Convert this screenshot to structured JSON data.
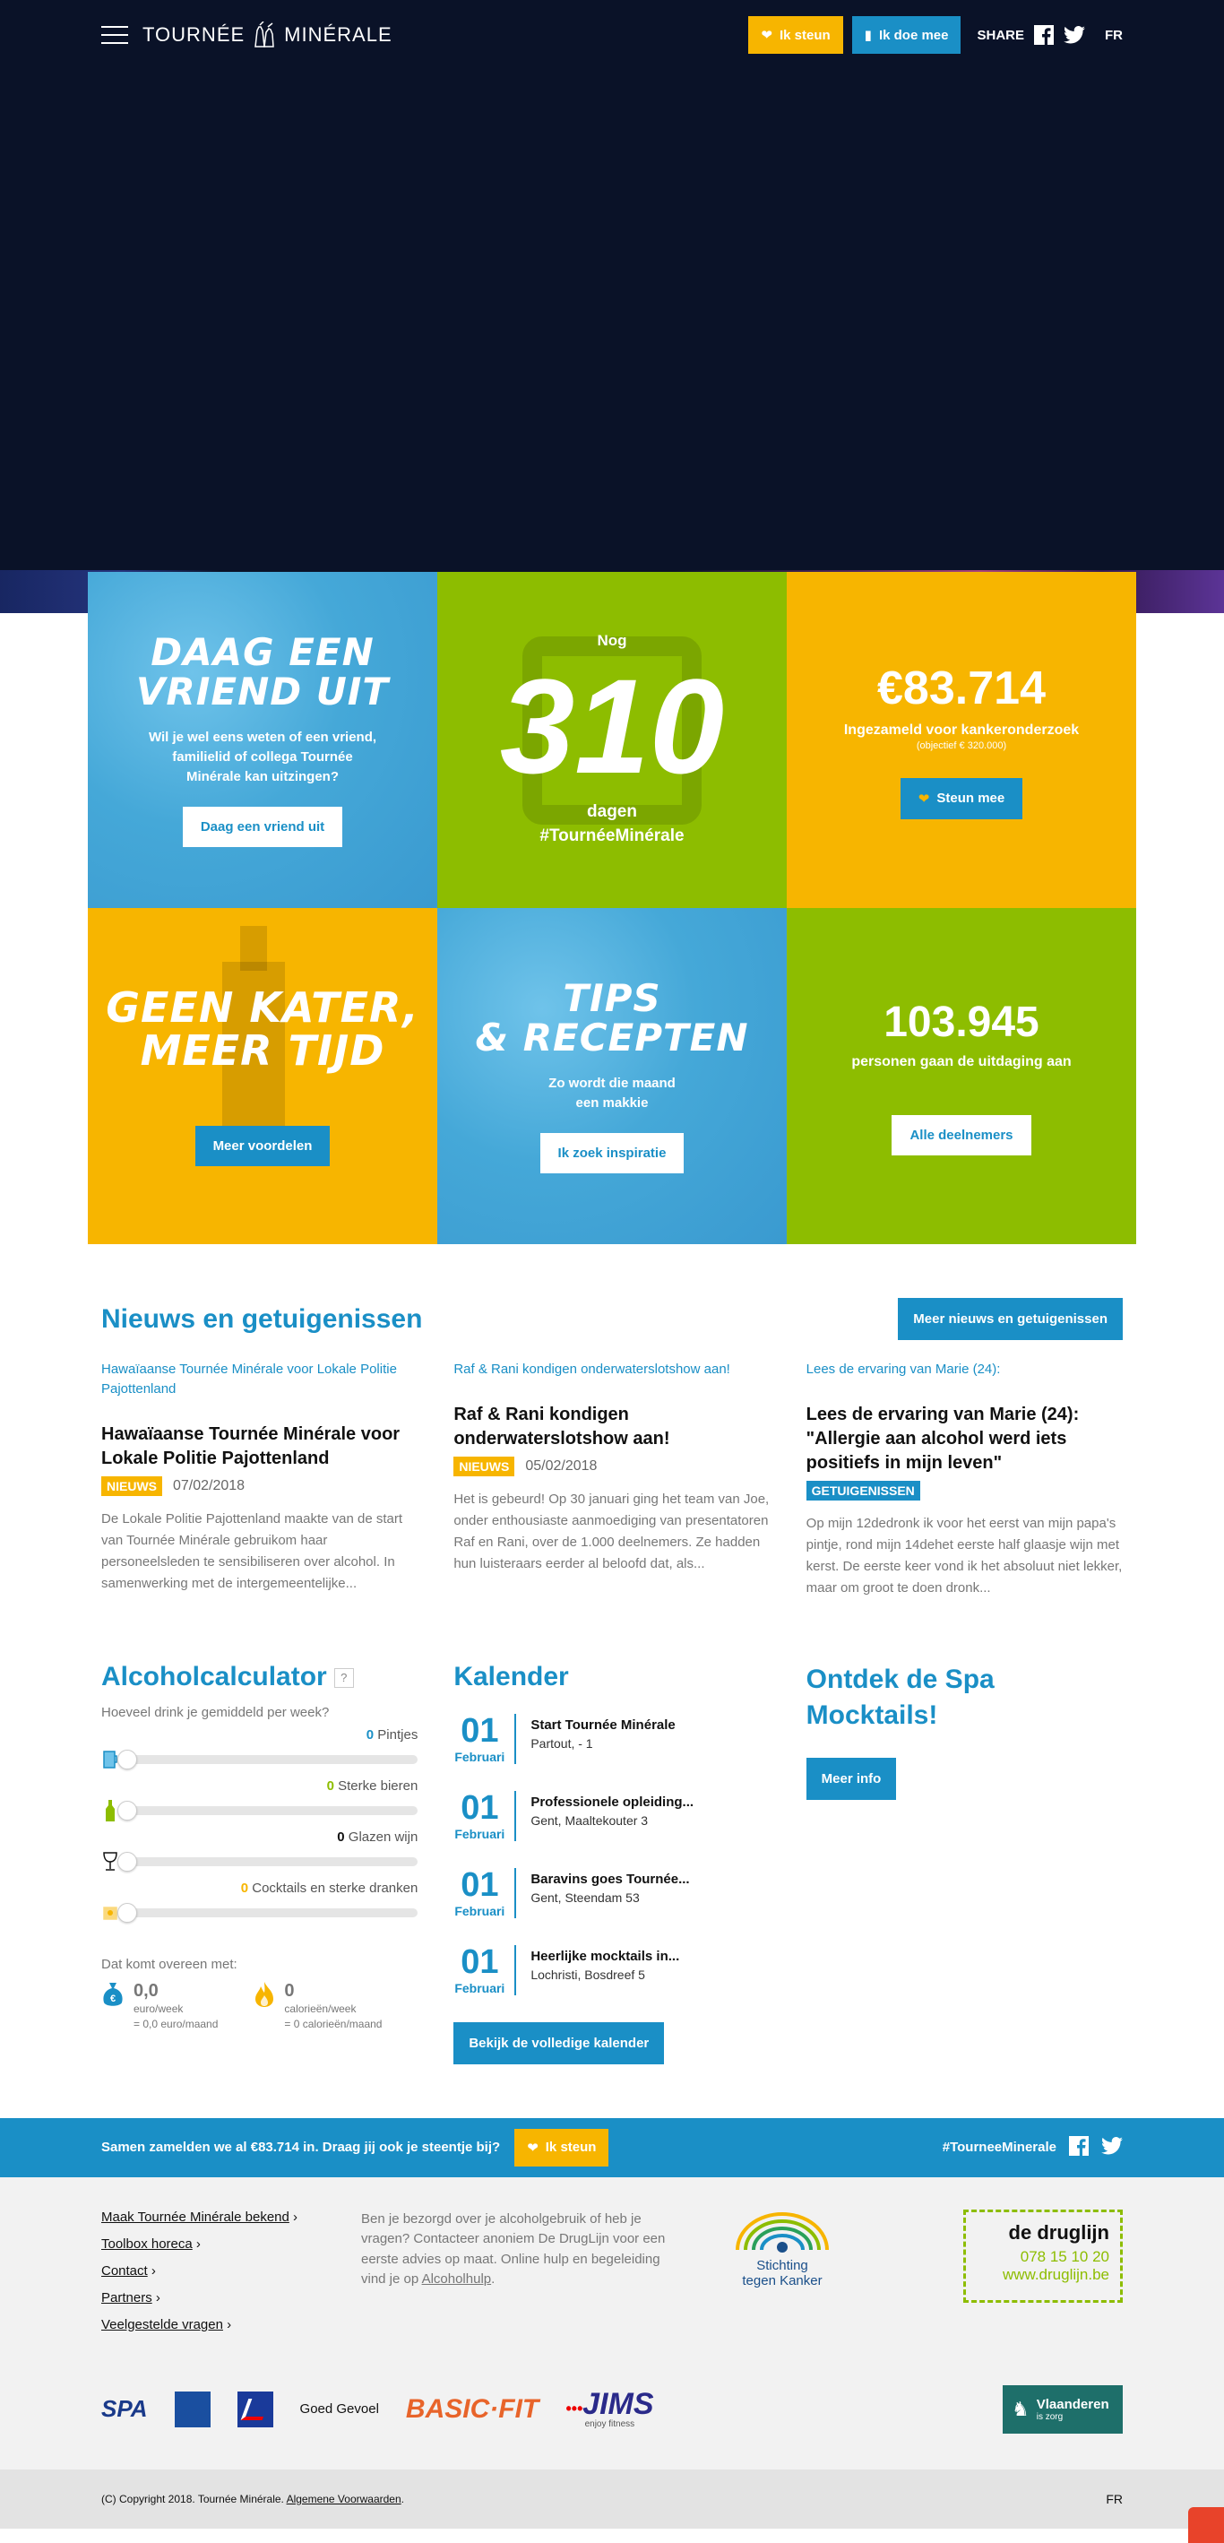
{
  "header": {
    "logo_left": "TOURNÉE",
    "logo_right": "MINÉRALE",
    "support_label": "Ik steun",
    "join_label": "Ik doe mee",
    "share_label": "SHARE",
    "lang": "FR"
  },
  "tiles": {
    "challenge": {
      "title_1": "DAAG EEN",
      "title_2": "VRIEND UIT",
      "text": "Wil je wel eens weten of een vriend, familielid of collega Tournée Minérale kan uitzingen?",
      "button": "Daag een vriend uit"
    },
    "countdown": {
      "prefix": "Nog",
      "number": "310",
      "unit": "dagen",
      "hashtag": "#TournéeMinérale"
    },
    "donation": {
      "amount": "€83.714",
      "label": "Ingezameld voor kankeronderzoek",
      "objective": "(objectief € 320.000)",
      "button": "Steun mee"
    },
    "benefits": {
      "title_1": "GEEN KATER,",
      "title_2": "MEER TIJD",
      "button": "Meer voordelen"
    },
    "tips": {
      "title_1": "TIPS",
      "title_2": "& RECEPTEN",
      "text": "Zo wordt die maand een makkie",
      "button": "Ik zoek inspiratie"
    },
    "participants": {
      "count": "103.945",
      "label": "personen gaan de uitdaging aan",
      "button": "Alle deelnemers"
    }
  },
  "news": {
    "title": "Nieuws en getuigenissen",
    "more_button": "Meer nieuws en getuigenissen",
    "items": [
      {
        "img_alt": "Hawaïaanse Tournée Minérale voor Lokale Politie Pajottenland",
        "title": "Hawaïaanse Tournée Minérale voor Lokale Politie Pajottenland",
        "tag": "NIEUWS",
        "date": "07/02/2018",
        "excerpt": "De Lokale Politie Pajottenland maakte van de start van Tournée Minérale gebruikom haar personeelsleden te sensibiliseren over alcohol. In samenwerking met de intergemeentelijke..."
      },
      {
        "img_alt": "Raf & Rani kondigen onderwaterslotshow aan!",
        "title": "Raf & Rani kondigen onderwaterslotshow aan!",
        "tag": "NIEUWS",
        "date": "05/02/2018",
        "excerpt": "Het is gebeurd! Op 30 januari ging het team van Joe, onder enthousiaste aanmoediging van presentatoren Raf en Rani, over de 1.000 deelnemers. Ze hadden hun luisteraars eerder al beloofd dat, als..."
      },
      {
        "img_alt": "Lees de ervaring van Marie (24):",
        "title": "Lees de ervaring van Marie (24): \"Allergie aan alcohol werd iets positiefs in mijn leven\"",
        "tag": "GETUIGENISSEN",
        "date": "",
        "excerpt": "Op mijn 12dedronk ik voor het eerst van mijn papa's pintje, rond mijn 14dehet eerste half glaasje wijn met kerst. De eerste keer vond ik het absoluut niet lekker, maar om groot te doen dronk..."
      }
    ]
  },
  "calculator": {
    "title": "Alcoholcalculator",
    "help": "?",
    "question": "Hoeveel drink je gemiddeld per week?",
    "rows": [
      {
        "value": "0",
        "label": "Pintjes",
        "color": "#1a8fc6"
      },
      {
        "value": "0",
        "label": "Sterke bieren",
        "color": "#8dbd00"
      },
      {
        "value": "0",
        "label": "Glazen wijn",
        "color": "#111111"
      },
      {
        "value": "0",
        "label": "Cocktails en sterke dranken",
        "color": "#f7b500"
      }
    ],
    "result_label": "Dat komt overeen met:",
    "money_value": "0,0",
    "money_unit_1": "euro/week",
    "money_unit_2": "= 0,0 euro/maand",
    "cal_value": "0",
    "cal_unit_1": "calorieën/week",
    "cal_unit_2": "= 0 calorieën/maand"
  },
  "calendar": {
    "title": "Kalender",
    "items": [
      {
        "day": "01",
        "month": "Februari",
        "title": "Start Tournée Minérale",
        "location": "Partout, - 1"
      },
      {
        "day": "01",
        "month": "Februari",
        "title": "Professionele opleiding...",
        "location": "Gent, Maaltekouter 3"
      },
      {
        "day": "01",
        "month": "Februari",
        "title": "Baravins goes Tournée...",
        "location": "Gent, Steendam 53"
      },
      {
        "day": "01",
        "month": "Februari",
        "title": "Heerlijke mocktails in...",
        "location": "Lochristi, Bosdreef 5"
      }
    ],
    "button": "Bekijk de volledige kalender"
  },
  "spa": {
    "title": "Ontdek de Spa Mocktails!",
    "button": "Meer info"
  },
  "banner": {
    "text": "Samen zamelden we al €83.714 in. Draag jij ook je steentje bij?",
    "button": "Ik steun",
    "hashtag": "#TourneeMinerale"
  },
  "footer": {
    "links": [
      "Maak Tournée Minérale bekend",
      "Toolbox horeca",
      "Contact",
      "Partners",
      "Veelgestelde vragen"
    ],
    "text_main": "Ben je bezorgd over je alcoholgebruik of heb je vragen? Contacteer anoniem De DrugLijn voor een eerste advies op maat. Online hulp en begeleiding vind je op ",
    "text_link": "Alcoholhulp",
    "text_end": ".",
    "stk_1": "Stichting",
    "stk_2": "tegen Kanker",
    "druglijn_name": "de druglijn",
    "druglijn_phone": "078 15 10 20",
    "druglijn_url": "www.druglijn.be",
    "sponsors": [
      "SPA",
      "Goed Gevoel",
      "BASIC·FIT",
      "JIMS"
    ],
    "jims_sub": "enjoy fitness",
    "vlaanderen": "Vlaanderen",
    "vlaanderen_sub": "is zorg",
    "copyright": "(C) Copyright 2018. Tournée Minérale.",
    "terms": "Algemene Voorwaarden",
    "lang": "FR"
  }
}
